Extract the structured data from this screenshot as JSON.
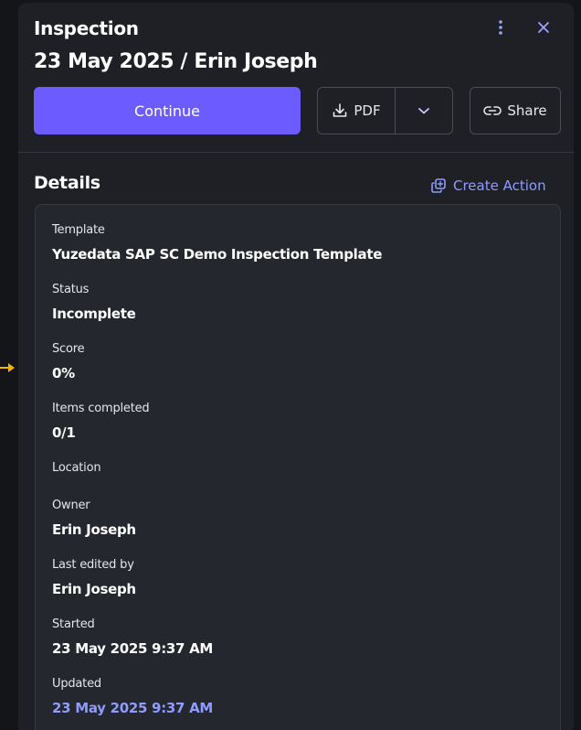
{
  "header": {
    "label": "Inspection",
    "title": "23 May 2025 / Erin Joseph"
  },
  "actions": {
    "continue_label": "Continue",
    "pdf_label": "PDF",
    "share_label": "Share"
  },
  "details": {
    "heading": "Details",
    "create_action_label": "Create Action",
    "fields": [
      {
        "label": "Template",
        "value": "Yuzedata SAP SC Demo Inspection Template"
      },
      {
        "label": "Status",
        "value": "Incomplete"
      },
      {
        "label": "Score",
        "value": "0%"
      },
      {
        "label": "Items completed",
        "value": "0/1"
      },
      {
        "label": "Location",
        "value": ""
      },
      {
        "label": "Owner",
        "value": "Erin Joseph"
      },
      {
        "label": "Last edited by",
        "value": "Erin Joseph"
      },
      {
        "label": "Started",
        "value": "23 May 2025 9:37 AM"
      },
      {
        "label": "Updated",
        "value": "23 May 2025 9:37 AM"
      }
    ]
  },
  "icons": {
    "more": "vertical-dots-icon",
    "close": "close-icon",
    "download": "download-icon",
    "caret": "chevron-down-icon",
    "share": "link-icon",
    "create_action": "copy-add-icon",
    "pointer": "arrow-right-icon"
  },
  "colors": {
    "background": "#141518",
    "panel": "#1f2026",
    "card": "#25272e",
    "accent": "#6c5cff",
    "link": "#8f9bff"
  }
}
